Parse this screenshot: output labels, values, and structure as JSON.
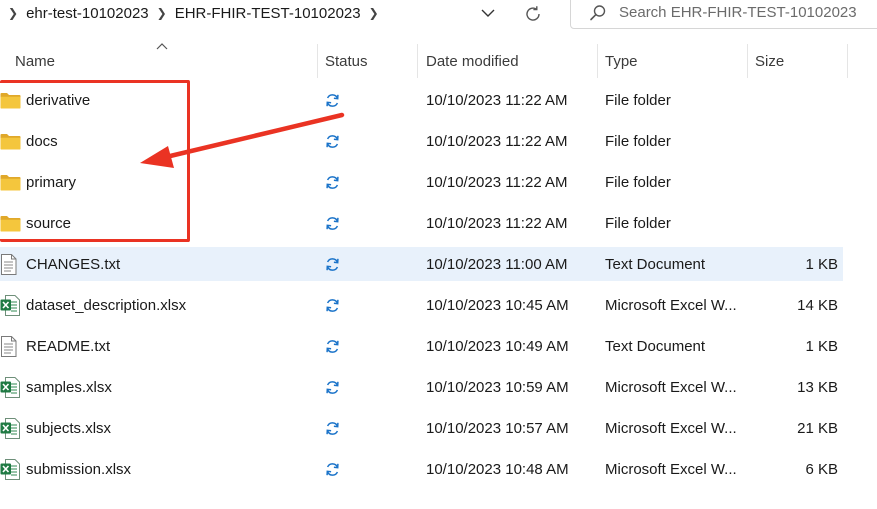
{
  "address_bar": {
    "breadcrumbs": [
      {
        "label": "ehr-test-10102023"
      },
      {
        "label": "EHR-FHIR-TEST-10102023"
      }
    ],
    "dropdown_icon": "chevron-down-icon",
    "refresh_icon": "refresh-icon"
  },
  "search": {
    "placeholder": "Search EHR-FHIR-TEST-10102023",
    "icon": "search-icon"
  },
  "columns": {
    "name": "Name",
    "status": "Status",
    "date": "Date modified",
    "type": "Type",
    "size": "Size"
  },
  "files": [
    {
      "name": "derivative",
      "icon": "folder-icon",
      "status_icon": "sync-icon",
      "date": "10/10/2023 11:22 AM",
      "type": "File folder",
      "size": "",
      "selected": false
    },
    {
      "name": "docs",
      "icon": "folder-icon",
      "status_icon": "sync-icon",
      "date": "10/10/2023 11:22 AM",
      "type": "File folder",
      "size": "",
      "selected": false
    },
    {
      "name": "primary",
      "icon": "folder-icon",
      "status_icon": "sync-icon",
      "date": "10/10/2023 11:22 AM",
      "type": "File folder",
      "size": "",
      "selected": false
    },
    {
      "name": "source",
      "icon": "folder-icon",
      "status_icon": "sync-icon",
      "date": "10/10/2023 11:22 AM",
      "type": "File folder",
      "size": "",
      "selected": false
    },
    {
      "name": "CHANGES.txt",
      "icon": "text-file-icon",
      "status_icon": "sync-icon",
      "date": "10/10/2023 11:00 AM",
      "type": "Text Document",
      "size": "1 KB",
      "selected": true
    },
    {
      "name": "dataset_description.xlsx",
      "icon": "excel-file-icon",
      "status_icon": "sync-icon",
      "date": "10/10/2023 10:45 AM",
      "type": "Microsoft Excel W...",
      "size": "14 KB",
      "selected": false
    },
    {
      "name": "README.txt",
      "icon": "text-file-icon",
      "status_icon": "sync-icon",
      "date": "10/10/2023 10:49 AM",
      "type": "Text Document",
      "size": "1 KB",
      "selected": false
    },
    {
      "name": "samples.xlsx",
      "icon": "excel-file-icon",
      "status_icon": "sync-icon",
      "date": "10/10/2023 10:59 AM",
      "type": "Microsoft Excel W...",
      "size": "13 KB",
      "selected": false
    },
    {
      "name": "subjects.xlsx",
      "icon": "excel-file-icon",
      "status_icon": "sync-icon",
      "date": "10/10/2023 10:57 AM",
      "type": "Microsoft Excel W...",
      "size": "21 KB",
      "selected": false
    },
    {
      "name": "submission.xlsx",
      "icon": "excel-file-icon",
      "status_icon": "sync-icon",
      "date": "10/10/2023 10:48 AM",
      "type": "Microsoft Excel W...",
      "size": "6 KB",
      "selected": false
    }
  ],
  "colors": {
    "folder": "#f4c63d",
    "folder_dark": "#e0a82a",
    "sync": "#1a73c9",
    "excel": "#1f7a43",
    "selection": "#e8f1fb",
    "annotation": "#ea3323"
  }
}
